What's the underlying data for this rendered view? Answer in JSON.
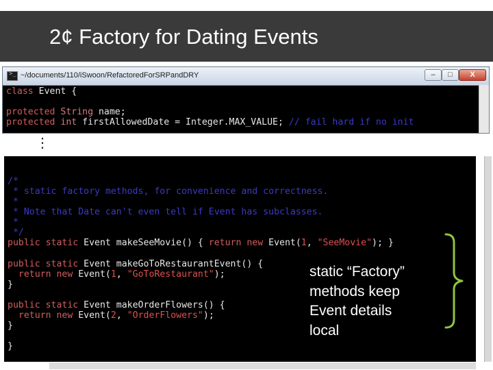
{
  "slide": {
    "title": "2¢ Factory for Dating Events"
  },
  "terminal": {
    "title": "~/documents/110/iSwoon/RefactoredForSRPandDRY",
    "minimize": "–",
    "maximize": "□",
    "close": "X",
    "prompt_glyph": ">_"
  },
  "code": {
    "class_decl": {
      "kw": "class",
      "name": " Event {"
    },
    "field1": {
      "kw": "protected",
      "type": " String",
      "rest": " name;"
    },
    "field2": {
      "kw": "protected",
      "type": " int",
      "rest": " firstAllowedDate = Integer.MAX_VALUE;",
      "comment": " // fail hard if no init"
    },
    "ellipsis": "⋮",
    "comment_lines": [
      "/*",
      " * static factory methods, for convenience and correctness.",
      " *",
      " * Note that Date can't even tell if Event has subclasses.",
      " *",
      " */"
    ],
    "see_movie": {
      "kw": "public static",
      "mid": " Event makeSeeMovie() { ",
      "ret": "return new",
      "call": " Event(",
      "num": "1",
      "sep": ", ",
      "str": "\"SeeMovie\"",
      "end": "); }"
    },
    "restaurant": {
      "kw": "public static",
      "mid": " Event makeGoToRestaurantEvent() {",
      "indent": "  ",
      "ret": "return new",
      "call": " Event(",
      "num": "1",
      "sep": ", ",
      "str": "\"GoToRestaurant\"",
      "end": ");",
      "close": "}"
    },
    "flowers": {
      "kw": "public static",
      "mid": " Event makeOrderFlowers() {",
      "indent": "  ",
      "ret": "return new",
      "call": " Event(",
      "num": "2",
      "sep": ", ",
      "str": "\"OrderFlowers\"",
      "end": ");",
      "close": "}"
    },
    "final_close": "}"
  },
  "callout": {
    "lines": [
      "static “Factory”",
      "methods keep",
      "Event details",
      "local"
    ]
  },
  "colors": {
    "keyword": "#d45d5d",
    "comment": "#3b39c9",
    "brace": "#8dc63f",
    "background": "#000000",
    "title_bar": "#3a3a3a"
  }
}
